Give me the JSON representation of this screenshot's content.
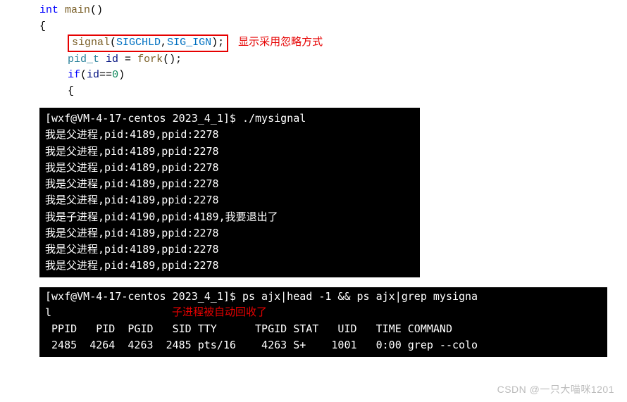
{
  "code": {
    "l1_kw": "int",
    "l1_fn": " main",
    "l1_rest": "()",
    "l2": "{",
    "l3_fn": "signal",
    "l3_open": "(",
    "l3_c1": "SIGCHLD",
    "l3_comma": ",",
    "l3_c2": "SIG_IGN",
    "l3_close": ");",
    "l3_annot": "显示采用忽略方式",
    "l4_type": "pid_t",
    "l4_sp": " ",
    "l4_var": "id",
    "l4_eq": " = ",
    "l4_fn": "fork",
    "l4_rest": "();",
    "l5_kw": "if",
    "l5_open": "(",
    "l5_var": "id",
    "l5_eq": "==",
    "l5_num": "0",
    "l5_close": ")",
    "l6": "{"
  },
  "term1": {
    "prompt": "[wxf@VM-4-17-centos 2023_4_1]$ ./mysignal",
    "lines": [
      "我是父进程,pid:4189,ppid:2278",
      "我是父进程,pid:4189,ppid:2278",
      "我是父进程,pid:4189,ppid:2278",
      "我是父进程,pid:4189,ppid:2278",
      "我是父进程,pid:4189,ppid:2278",
      "我是子进程,pid:4190,ppid:4189,我要退出了",
      "我是父进程,pid:4189,ppid:2278",
      "我是父进程,pid:4189,ppid:2278",
      "我是父进程,pid:4189,ppid:2278"
    ]
  },
  "term2": {
    "prompt": "[wxf@VM-4-17-centos 2023_4_1]$ ps ajx|head -1 && ps ajx|grep mysigna",
    "wrap": "l",
    "annot": "子进程被自动回收了",
    "header": " PPID   PID  PGID   SID TTY      TPGID STAT   UID   TIME COMMAND",
    "row": " 2485  4264  4263  2485 pts/16    4263 S+    1001   0:00 grep --colo"
  },
  "watermark": "CSDN @一只大喵咪1201"
}
